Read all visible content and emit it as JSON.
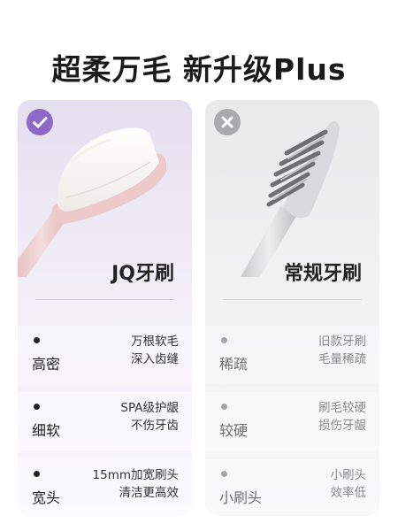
{
  "headline": "超柔万毛 新升级Plus",
  "left_card": {
    "badge_icon": "check-icon",
    "accent_color": "#8c68c8",
    "title": "JQ牙刷",
    "rows": [
      {
        "label": "高密",
        "desc_line1": "万根软毛",
        "desc_line2": "深入齿缝"
      },
      {
        "label": "细软",
        "desc_line1": "SPA级护龈",
        "desc_line2": "不伤牙齿"
      },
      {
        "label": "宽头",
        "desc_line1": "15mm加宽刷头",
        "desc_line2": "清洁更高效"
      }
    ]
  },
  "right_card": {
    "badge_icon": "cross-icon",
    "accent_color": "#a9a9ab",
    "title": "常规牙刷",
    "rows": [
      {
        "label": "稀疏",
        "desc_line1": "旧款牙刷",
        "desc_line2": "毛量稀疏"
      },
      {
        "label": "较硬",
        "desc_line1": "刷毛较硬",
        "desc_line2": "损伤牙龈"
      },
      {
        "label": "小刷头",
        "desc_line1": "小刷头",
        "desc_line2": "效率低"
      }
    ]
  }
}
